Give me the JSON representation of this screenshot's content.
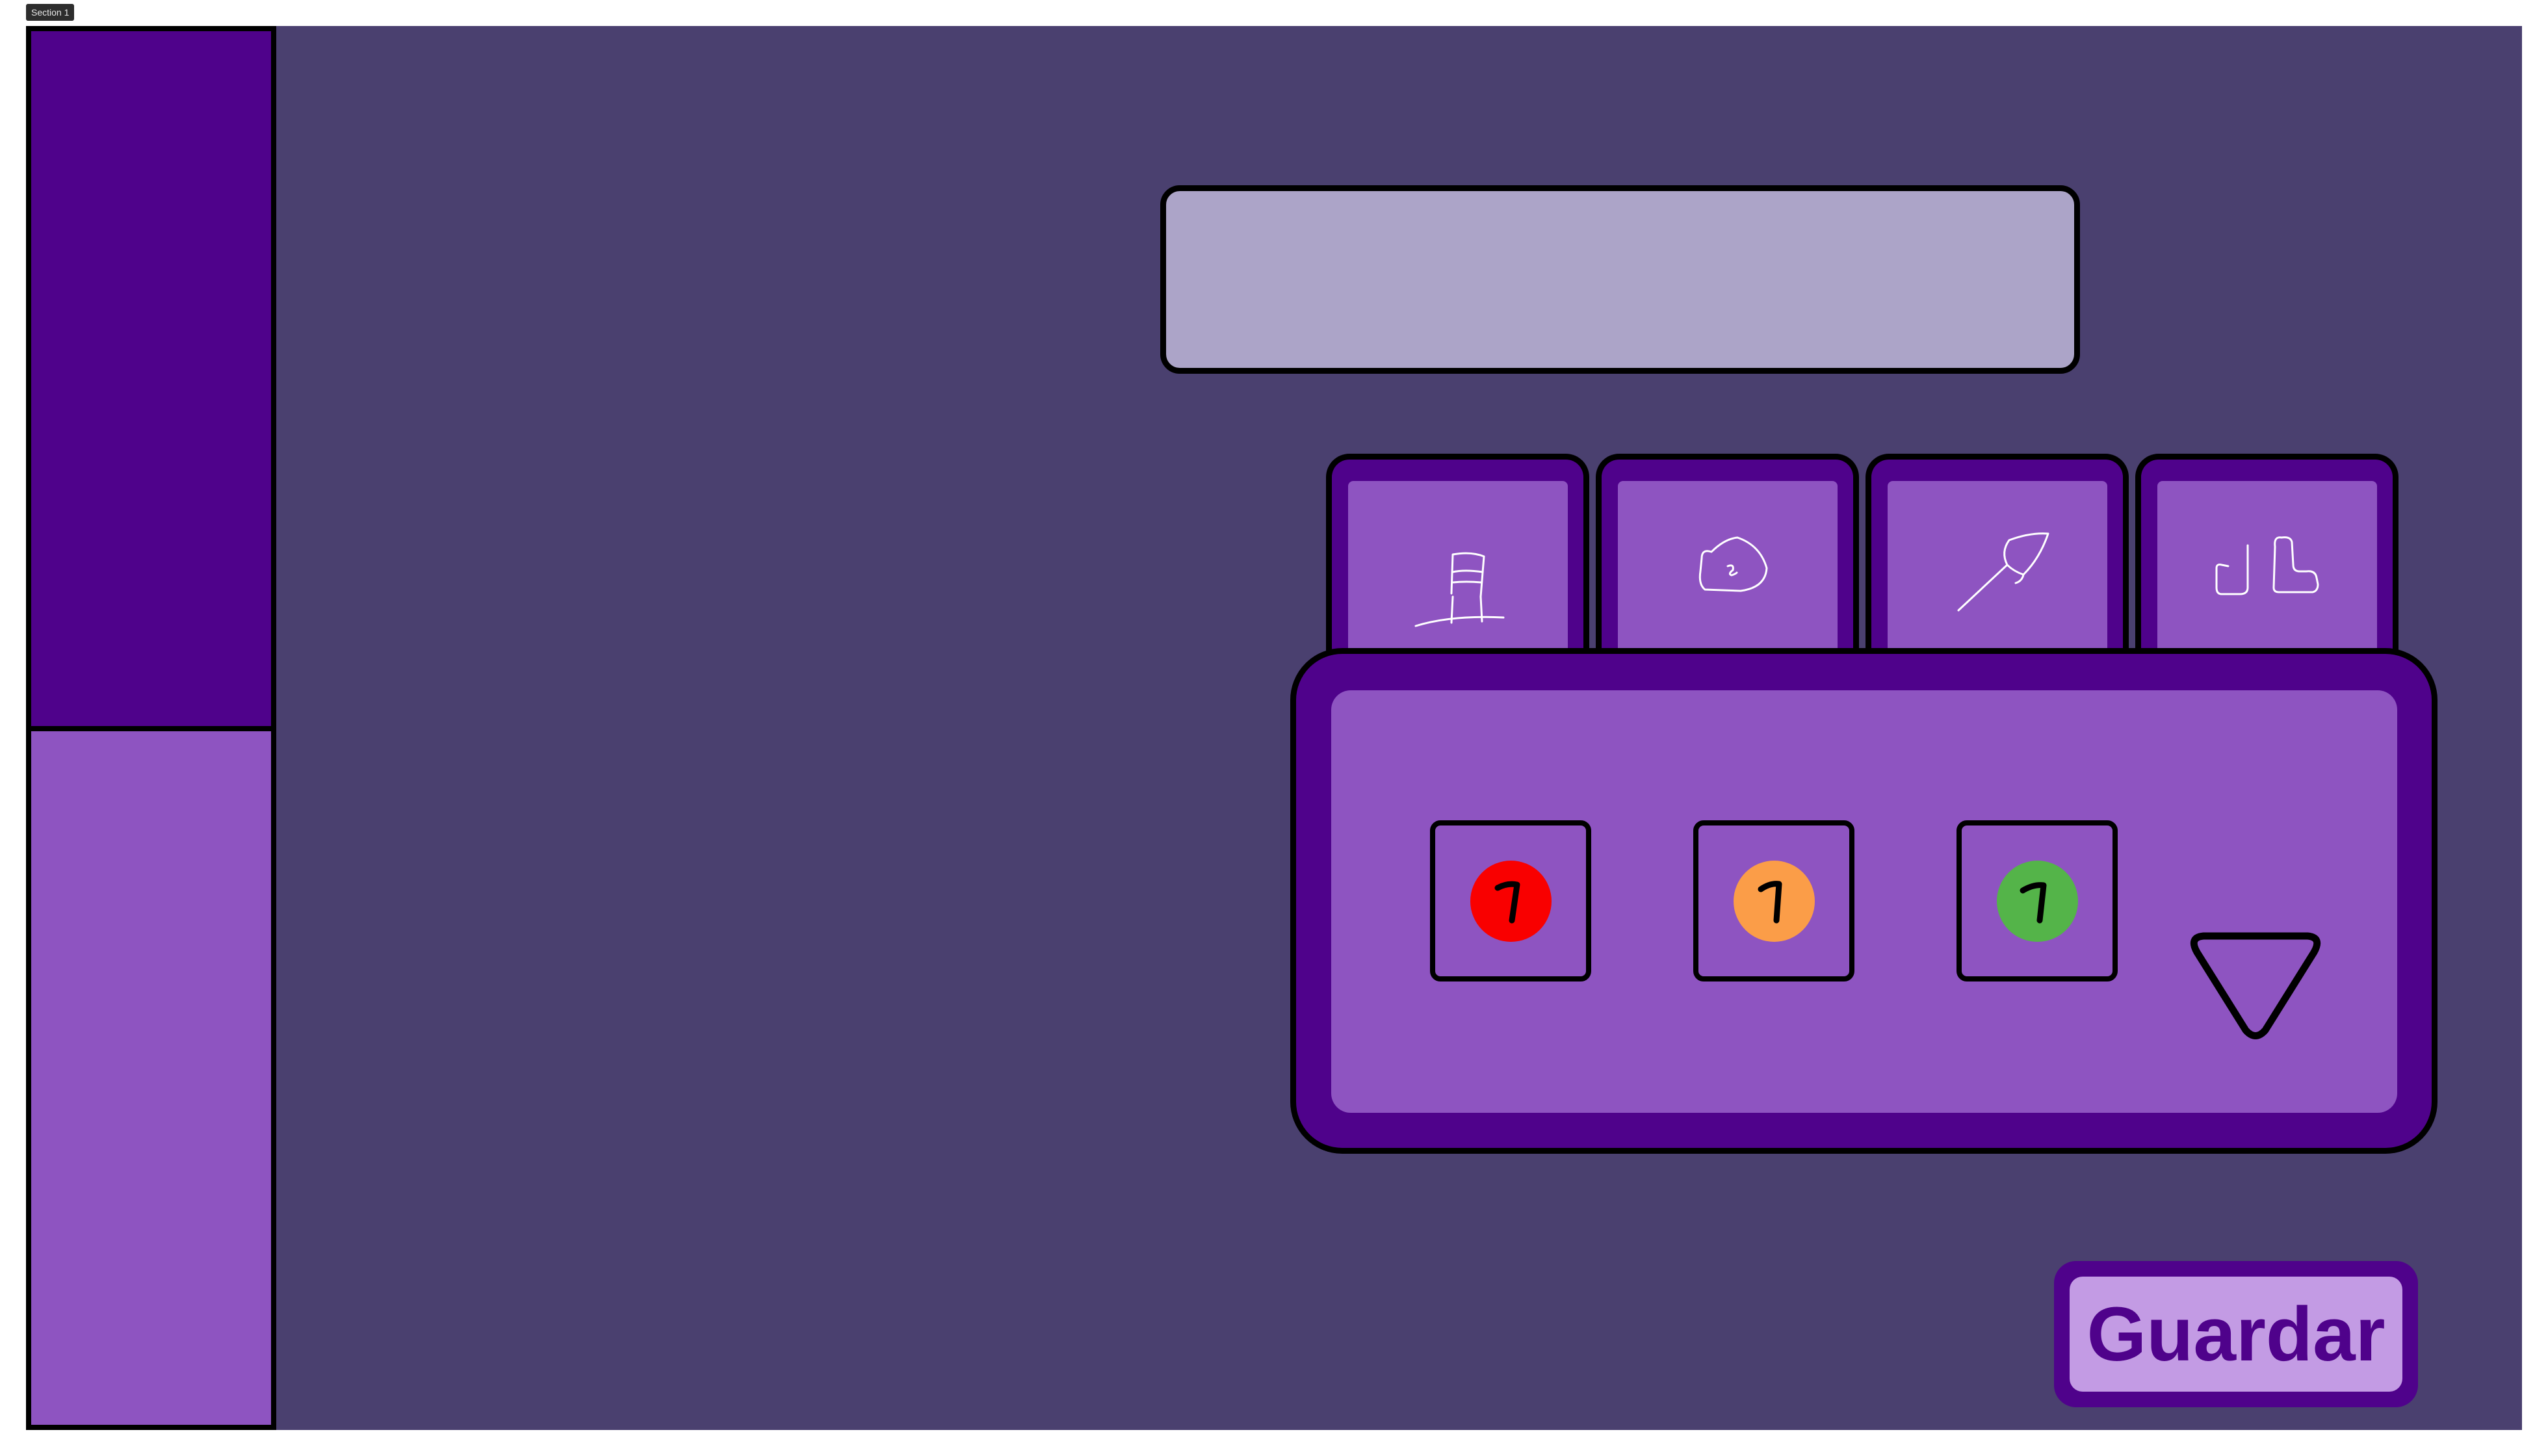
{
  "section_label": "Section 1",
  "tabs": [
    {
      "icon": "chef-hat-icon",
      "active": true
    },
    {
      "icon": "pouch-icon",
      "active": false
    },
    {
      "icon": "leaf-icon",
      "active": false
    },
    {
      "icon": "shoes-icon",
      "active": false
    }
  ],
  "items": [
    {
      "value": "1",
      "color": "#f90000"
    },
    {
      "value": "1",
      "color": "#fb9d48"
    },
    {
      "value": "1",
      "color": "#54b449"
    }
  ],
  "save_button": {
    "label": "Guardar"
  },
  "colors": {
    "background": "#4a406f",
    "dark_purple": "#4f028b",
    "mid_purple": "#8e54c1",
    "light_purple": "#c39be4",
    "text_field": "#aca4c8"
  }
}
